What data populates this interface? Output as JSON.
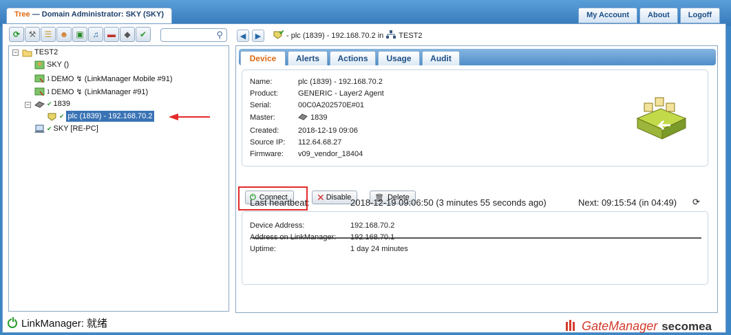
{
  "header": {
    "tree_label": "Tree",
    "title": "— Domain Administrator: SKY (SKY)",
    "links": [
      "My Account",
      "About",
      "Logoff"
    ]
  },
  "toolbar": {
    "icons": [
      "refresh-icon",
      "tools-icon",
      "tree-icon",
      "user-icon",
      "screen-icon",
      "bell-icon",
      "toolbox-icon",
      "device-icon",
      "check-device-icon"
    ],
    "search_placeholder": ""
  },
  "tree": {
    "root": "TEST2",
    "nodes": [
      {
        "label": "SKY ()",
        "badge": ""
      },
      {
        "label": "DEMO ↯ (LinkManager Mobile #91)",
        "badge": "1"
      },
      {
        "label": "DEMO ↯ (LinkManager #91)",
        "badge": "1"
      },
      {
        "label": "1839",
        "badge": "✔"
      },
      {
        "label": "plc (1839) - 192.168.70.2",
        "badge": "✔"
      },
      {
        "label": "SKY [RE-PC]",
        "badge": "✔"
      }
    ]
  },
  "status": {
    "text": "LinkManager: 就绪"
  },
  "brand": {
    "gatemanager": "GateManager",
    "secomea": "secomea"
  },
  "breadcrumb": {
    "item": "- plc (1839) - 192.168.70.2 in",
    "domain": "TEST2"
  },
  "tabs": [
    "Device",
    "Alerts",
    "Actions",
    "Usage",
    "Audit"
  ],
  "device": {
    "fields": [
      {
        "label": "Name:",
        "value": "plc (1839) - 192.168.70.2"
      },
      {
        "label": "Product:",
        "value": "GENERIC - Layer2 Agent"
      },
      {
        "label": "Serial:",
        "value": "00C0A202570E#01"
      },
      {
        "label": "Master:",
        "value": "1839"
      },
      {
        "label": "Created:",
        "value": "2018-12-19 09:06"
      },
      {
        "label": "Source IP:",
        "value": "112.64.68.27"
      },
      {
        "label": "Firmware:",
        "value": "v09_vendor_18404"
      }
    ]
  },
  "buttons": {
    "connect": "Connect",
    "disable": "Disable",
    "delete": "Delete"
  },
  "heartbeat": {
    "label": "Last heartbeat:",
    "value": "2018-12-19 09:06:50 (3 minutes 55 seconds ago)",
    "next": "Next: 09:15:54 (in 04:49)",
    "fields": [
      {
        "label": "Device Address:",
        "value": "192.168.70.2"
      },
      {
        "label": "Address on LinkManager:",
        "value": "192.168.70.1"
      },
      {
        "label": "Uptime:",
        "value": "1 day 24 minutes"
      }
    ]
  },
  "colors": {
    "accent": "#e06a14",
    "header_bg": "#3d86c6",
    "selection": "#3a73b5",
    "highlight": "#e42a2a"
  }
}
